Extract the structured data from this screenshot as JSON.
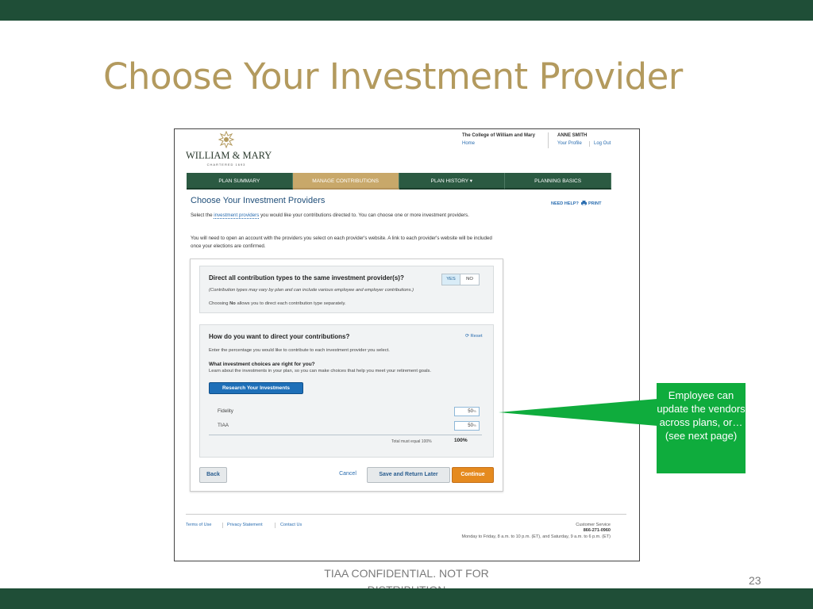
{
  "slide": {
    "title": "Choose Your Investment Provider",
    "confidential": "TIAA CONFIDENTIAL. NOT FOR DISTRIBUTION",
    "page_number": "23",
    "callout": "Employee can update the vendors across plans, or…(see next page)",
    "colors": {
      "bar": "#1f4e37",
      "title": "#b39a5e",
      "callout": "#0fac3d"
    }
  },
  "header": {
    "logo_name": "WILLIAM & MARY",
    "logo_sub": "CHARTERED 1693",
    "college": "The College of William and Mary",
    "home": "Home",
    "user": "ANNE SMITH",
    "profile": "Your Profile",
    "logout": "Log Out"
  },
  "nav": {
    "tabs": [
      {
        "label": "PLAN SUMMARY"
      },
      {
        "label": "MANAGE CONTRIBUTIONS"
      },
      {
        "label": "PLAN HISTORY ▾"
      },
      {
        "label": "PLANNING BASICS"
      }
    ],
    "active_index": 1
  },
  "page": {
    "heading": "Choose Your Investment Providers",
    "need_help": "NEED HELP?",
    "print": "PRINT",
    "intro1_pre": "Select the ",
    "intro1_link": "investment providers",
    "intro1_post": " you would like your contributions directed to. You can choose one or more investment providers.",
    "intro2": "You will need to open an account with the providers you select on each provider's website. A link to each provider's website will be included once your elections are confirmed."
  },
  "box1": {
    "question": "Direct all contribution types to the same investment provider(s)?",
    "note": "(Contribution types may vary by plan and can include various employee and employer contributions.)",
    "choose_pre": "Choosing ",
    "choose_bold": "No",
    "choose_post": " allows you to direct each contribution type separately.",
    "yes": "YES",
    "no": "NO",
    "selected": "YES"
  },
  "box2": {
    "question": "How do you want to direct your contributions?",
    "reset": "Reset",
    "instruction": "Enter the percentage you would like to contribute to each investment provider you select.",
    "choices_heading": "What investment choices are right for you?",
    "choices_text": "Learn about the investments in your plan, so you can make choices that help you meet your retirement goals.",
    "research_button": "Research Your Investments",
    "providers": [
      {
        "name": "Fidelity",
        "value": "50",
        "unit": "%"
      },
      {
        "name": "TIAA",
        "value": "50",
        "unit": "%"
      }
    ],
    "total_label": "Total must equal 100%",
    "total_value": "100%"
  },
  "buttons": {
    "back": "Back",
    "cancel": "Cancel",
    "save": "Save and Return Later",
    "continue": "Continue"
  },
  "footer": {
    "links": [
      "Terms of Use",
      "Privacy Statement",
      "Contact Us"
    ],
    "cs_title": "Customer Service",
    "cs_phone": "866-271-0960",
    "cs_hours": "Monday to Friday, 8 a.m. to 10 p.m. (ET), and Saturday, 9 a.m. to 6 p.m. (ET)"
  }
}
